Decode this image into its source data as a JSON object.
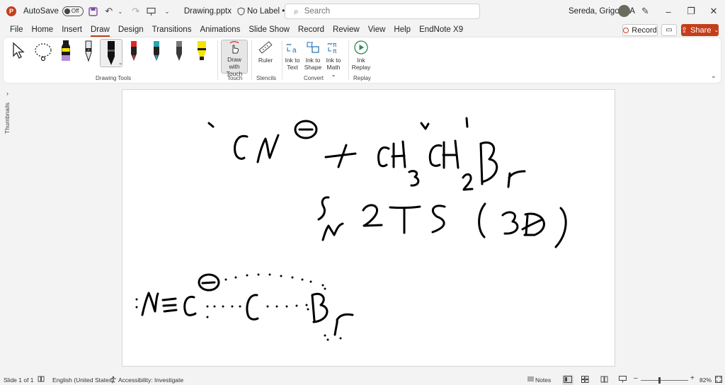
{
  "titlebar": {
    "autosave_label": "AutoSave",
    "autosave_state": "Off",
    "filename": "Drawing.pptx",
    "label_status": "No Label • Saved to this PC",
    "search_placeholder": "Search",
    "user_name": "Sereda, Grigoriy A"
  },
  "tabs": [
    "File",
    "Home",
    "Insert",
    "Draw",
    "Design",
    "Transitions",
    "Animations",
    "Slide Show",
    "Record",
    "Review",
    "View",
    "Help",
    "EndNote X9"
  ],
  "active_tab": "Draw",
  "actions": {
    "record": "Record",
    "share": "Share"
  },
  "ribbon": {
    "groups": {
      "drawing_tools": "Drawing Tools",
      "touch": "Touch",
      "stencils": "Stencils",
      "convert": "Convert",
      "replay": "Replay"
    },
    "buttons": {
      "draw_with_touch_1": "Draw with",
      "draw_with_touch_2": "Touch",
      "ruler": "Ruler",
      "ink_to_text_1": "Ink to",
      "ink_to_text_2": "Text",
      "ink_to_shape_1": "Ink to",
      "ink_to_shape_2": "Shape",
      "ink_to_math_1": "Ink to",
      "ink_to_math_2": "Math ⌄",
      "ink_replay_1": "Ink",
      "ink_replay_2": "Replay"
    },
    "pen_colors": {
      "highlighter_purple": "#b48fd6",
      "pen_gray": "#8a8a8a",
      "pen_black": "#111111",
      "pen_red": "#e02828",
      "pen_teal": "#2aa3b6",
      "pen_dark": "#3a3a3a",
      "highlighter_yellow": "#f5e400"
    }
  },
  "sidebar": {
    "thumbnails_label": "Thumbnails"
  },
  "statusbar": {
    "slide_info": "Slide 1 of 1",
    "language": "English (United States)",
    "accessibility": "Accessibility: Investigate",
    "notes": "Notes",
    "zoom": "82%"
  }
}
